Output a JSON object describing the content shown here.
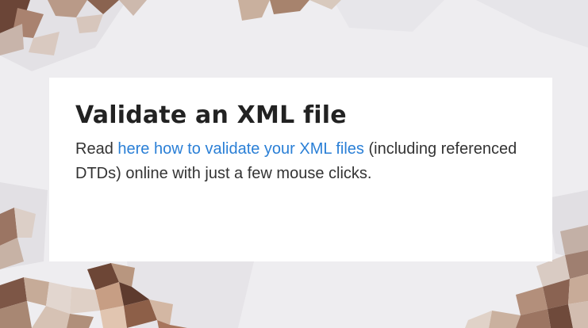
{
  "card": {
    "title": "Validate an XML file",
    "text_before": "Read ",
    "link_text": "here how to validate your XML files",
    "text_after": " (including referenced DTDs) online with just a few mouse clicks."
  },
  "colors": {
    "title": "#222222",
    "body_text": "#333333",
    "link": "#2a7fd6",
    "background": "#eeedf0"
  }
}
